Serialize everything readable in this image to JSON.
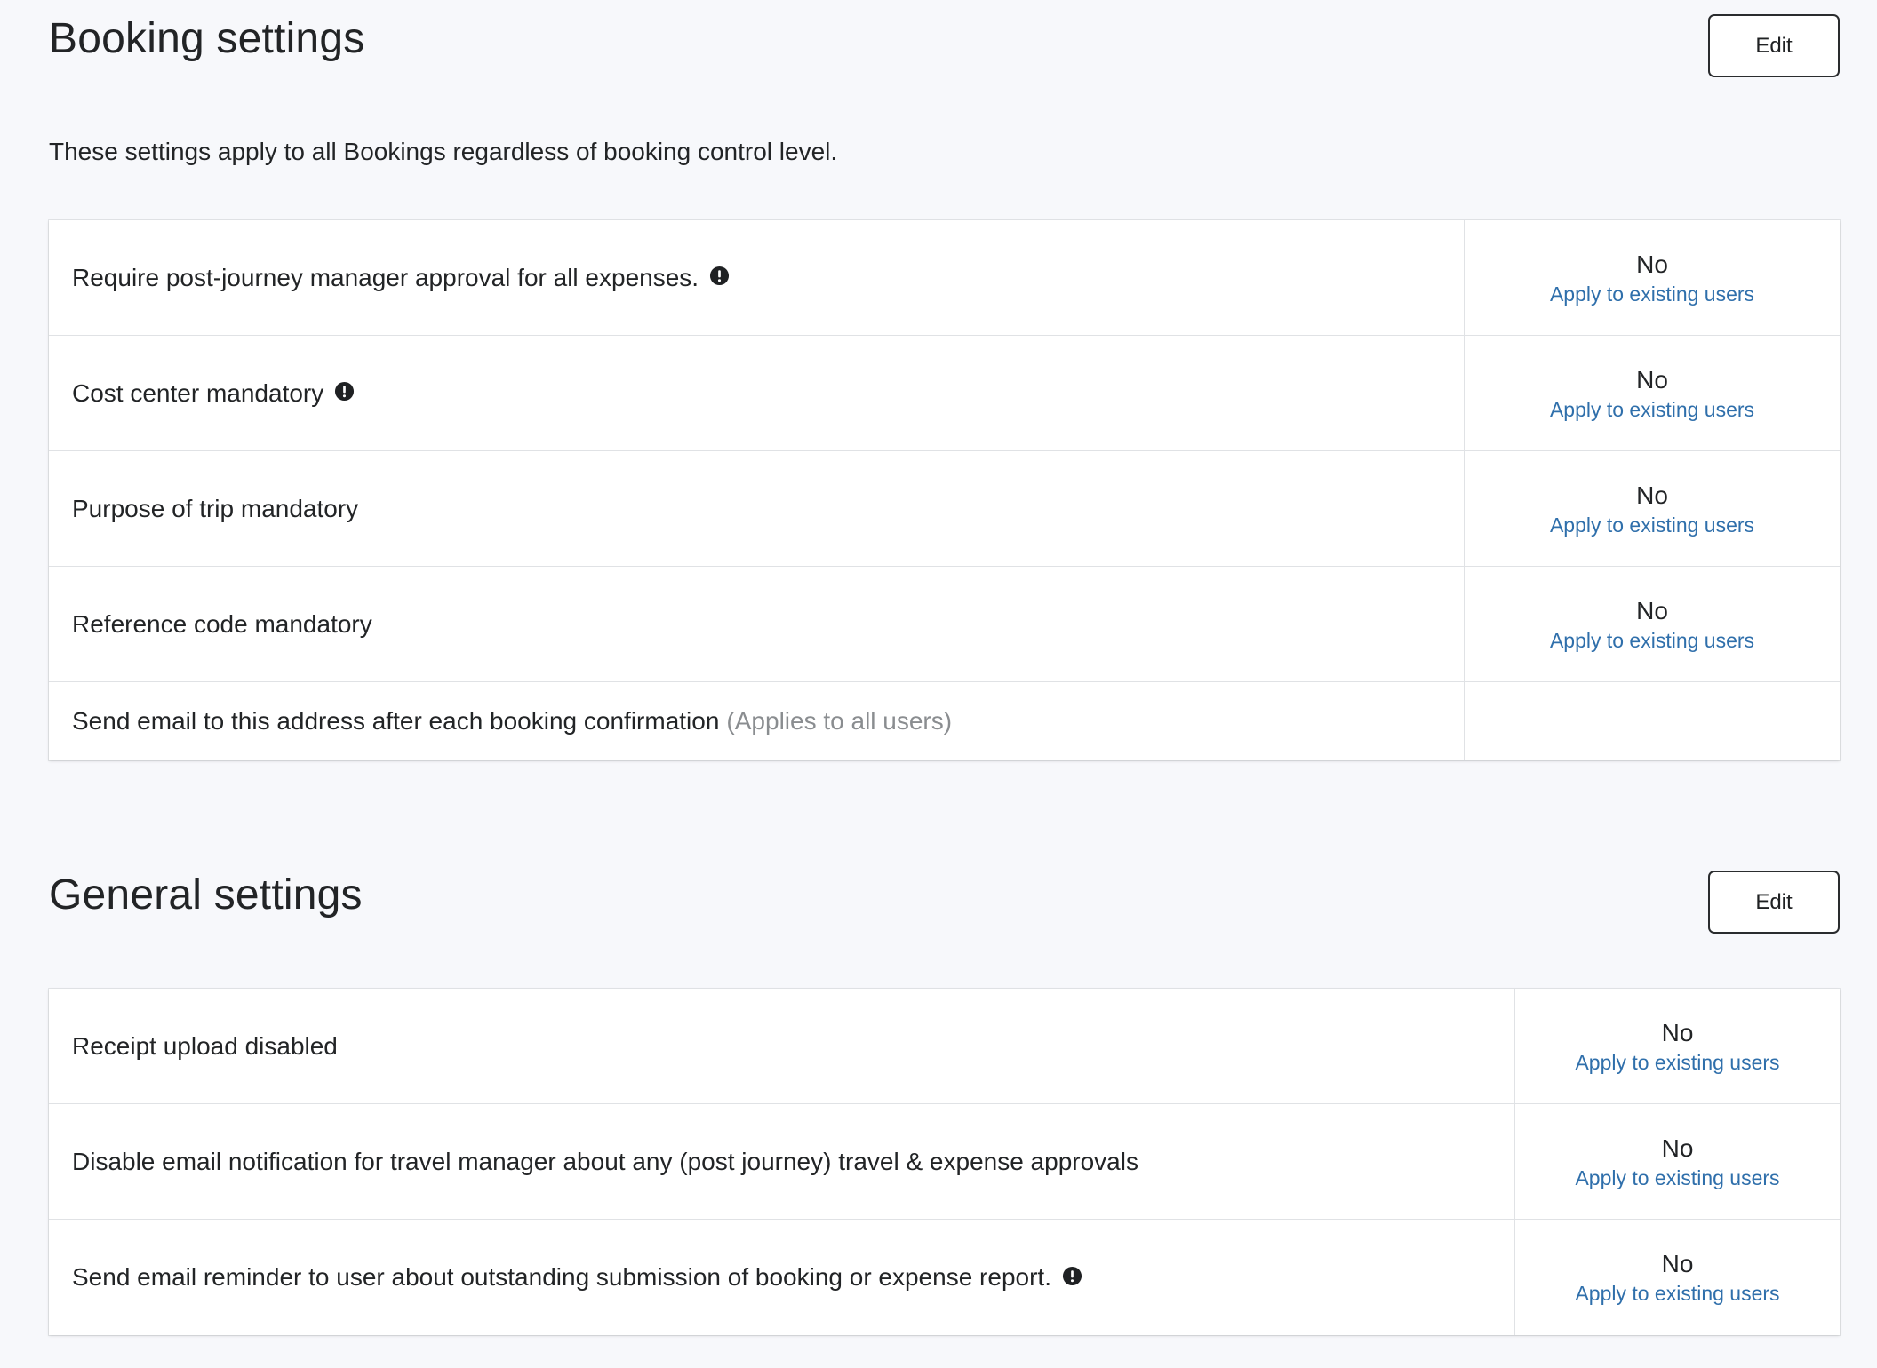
{
  "booking": {
    "title": "Booking settings",
    "edit_label": "Edit",
    "description": "These settings apply to all Bookings regardless of booking control level.",
    "rows": [
      {
        "label": "Require post-journey manager approval for all expenses.",
        "value": "No",
        "link": "Apply to existing users"
      },
      {
        "label": "Cost center mandatory",
        "value": "No",
        "link": "Apply to existing users"
      },
      {
        "label": "Purpose of trip mandatory",
        "value": "No",
        "link": "Apply to existing users"
      },
      {
        "label": "Reference code mandatory",
        "value": "No",
        "link": "Apply to existing users"
      },
      {
        "label": "Send email to this address after each booking confirmation",
        "note": "(Applies to all users)",
        "value": ""
      }
    ]
  },
  "general": {
    "title": "General settings",
    "edit_label": "Edit",
    "rows": [
      {
        "label": "Receipt upload disabled",
        "value": "No",
        "link": "Apply to existing users"
      },
      {
        "label": "Disable email notification for travel manager about any (post journey) travel & expense approvals",
        "value": "No",
        "link": "Apply to existing users"
      },
      {
        "label": "Send email reminder to user about outstanding submission of booking or expense report.",
        "value": "No",
        "link": "Apply to existing users"
      }
    ]
  },
  "icons": {
    "info": "exclamation-circle-icon"
  },
  "colors": {
    "link": "#2f6fab",
    "muted": "#8a8d90",
    "background": "#f7f8fb"
  }
}
